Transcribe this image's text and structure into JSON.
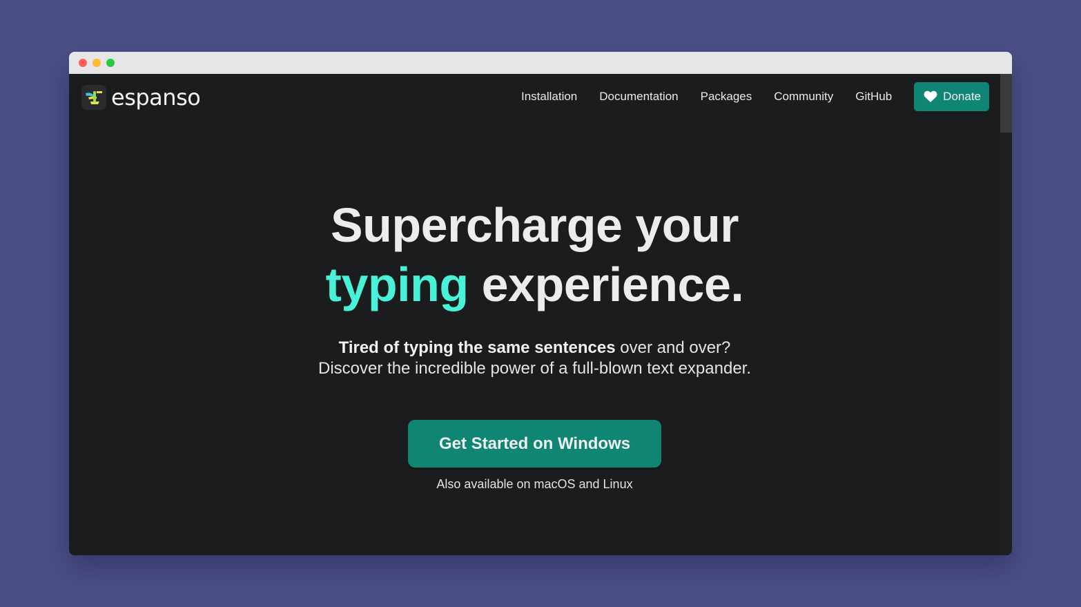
{
  "brand": {
    "name": "espanso",
    "logo_icon": "espanso-logo-icon"
  },
  "nav": {
    "items": [
      {
        "label": "Installation"
      },
      {
        "label": "Documentation"
      },
      {
        "label": "Packages"
      },
      {
        "label": "Community"
      },
      {
        "label": "GitHub"
      }
    ],
    "donate": {
      "label": "Donate",
      "icon": "heart-icon"
    }
  },
  "hero": {
    "headline_line1": "Supercharge your",
    "headline_accent": "typing",
    "headline_rest": "experience.",
    "subtitle_bold": "Tired of typing the same sentences",
    "subtitle_normal": "over and over?",
    "subtitle_line2": "Discover the incredible power of a full-blown text expander.",
    "cta_label": "Get Started on Windows",
    "also_available": "Also available on macOS and Linux"
  },
  "colors": {
    "page_bg": "#1b1c1e",
    "accent": "#47f2d8",
    "button": "#0f8574",
    "backdrop": "#4a4f86"
  }
}
